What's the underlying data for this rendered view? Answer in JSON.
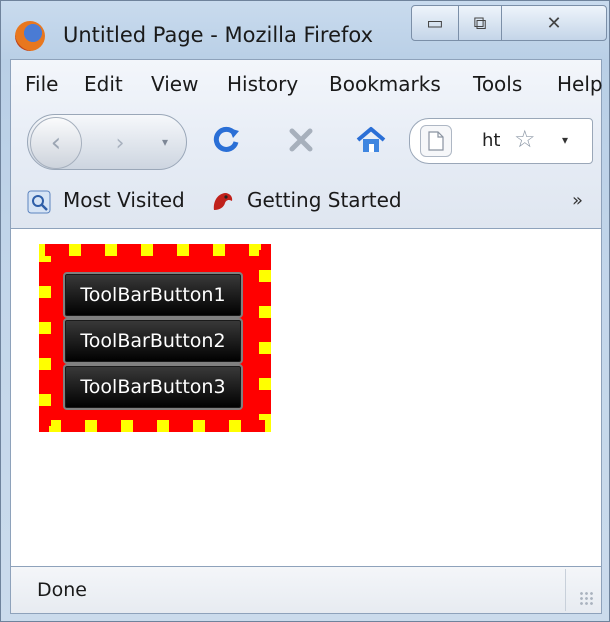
{
  "window": {
    "title": "Untitled Page - Mozilla Firefox",
    "minimize_glyph": "▭",
    "maximize_glyph": "⧉",
    "close_glyph": "✕"
  },
  "menubar": {
    "items": [
      "File",
      "Edit",
      "View",
      "History",
      "Bookmarks",
      "Tools",
      "Help"
    ]
  },
  "navbar": {
    "url_text": "ht",
    "back_glyph": "‹",
    "forward_glyph": "›",
    "dropdown_glyph": "▾",
    "url_dropdown_glyph": "▾",
    "star_glyph": "☆"
  },
  "bookmarks": {
    "most_visited": "Most Visited",
    "getting_started": "Getting Started",
    "overflow": "»"
  },
  "content": {
    "buttons": [
      "ToolBarButton1",
      "ToolBarButton2",
      "ToolBarButton3"
    ],
    "colors": {
      "border_dash_a": "#ffff00",
      "border_dash_b": "#ff0000",
      "button_bg": "#000000"
    }
  },
  "status": {
    "text": "Done"
  }
}
